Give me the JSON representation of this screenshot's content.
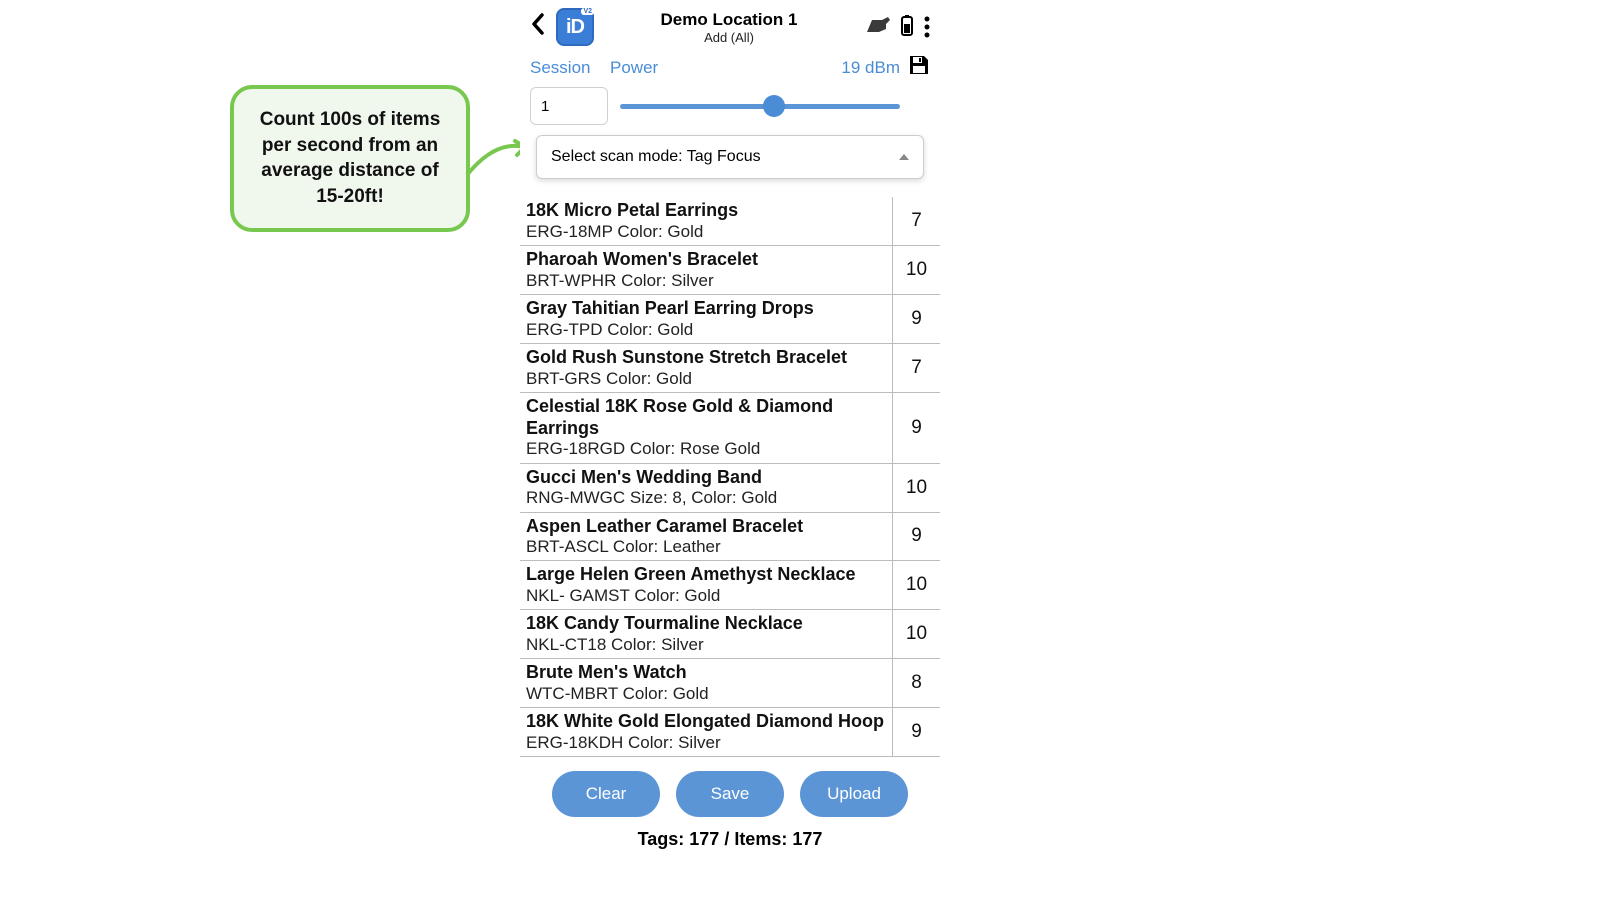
{
  "callout": {
    "text": "Count 100s of items per second from an average distance of 15-20ft!"
  },
  "header": {
    "logo_text": "iD",
    "logo_badge": "V2",
    "title": "Demo Location 1",
    "subtitle": "Add (All)"
  },
  "controls": {
    "session_label": "Session",
    "power_label": "Power",
    "dbm_label": "19 dBm",
    "session_value": "1",
    "scan_mode_prefix": "Select scan mode:  ",
    "scan_mode_value": "Tag Focus"
  },
  "items": [
    {
      "title": "18K Micro Petal Earrings",
      "sub": "ERG-18MP Color: Gold",
      "count": "7"
    },
    {
      "title": "Pharoah Women's Bracelet",
      "sub": "BRT-WPHR Color: Silver",
      "count": "10"
    },
    {
      "title": "Gray Tahitian Pearl Earring Drops",
      "sub": "ERG-TPD Color: Gold",
      "count": "9"
    },
    {
      "title": "Gold Rush Sunstone Stretch Bracelet",
      "sub": "BRT-GRS Color: Gold",
      "count": "7"
    },
    {
      "title": "Celestial 18K Rose Gold & Diamond Earrings",
      "sub": "ERG-18RGD Color: Rose Gold",
      "count": "9"
    },
    {
      "title": "Gucci Men's Wedding Band",
      "sub": "RNG-MWGC Size: 8, Color: Gold",
      "count": "10"
    },
    {
      "title": "Aspen Leather Caramel Bracelet",
      "sub": "BRT-ASCL Color: Leather",
      "count": "9"
    },
    {
      "title": "Large Helen Green Amethyst Necklace",
      "sub": "NKL- GAMST Color: Gold",
      "count": "10"
    },
    {
      "title": "18K Candy Tourmaline Necklace",
      "sub": "NKL-CT18 Color: Silver",
      "count": "10"
    },
    {
      "title": "Brute Men's Watch",
      "sub": "WTC-MBRT Color: Gold",
      "count": "8"
    },
    {
      "title": "18K White Gold Elongated Diamond Hoop",
      "sub": "ERG-18KDH Color: Silver",
      "count": "9"
    }
  ],
  "buttons": {
    "clear": "Clear",
    "save": "Save",
    "upload": "Upload"
  },
  "footer": {
    "text": "Tags: 177 / Items: 177"
  }
}
